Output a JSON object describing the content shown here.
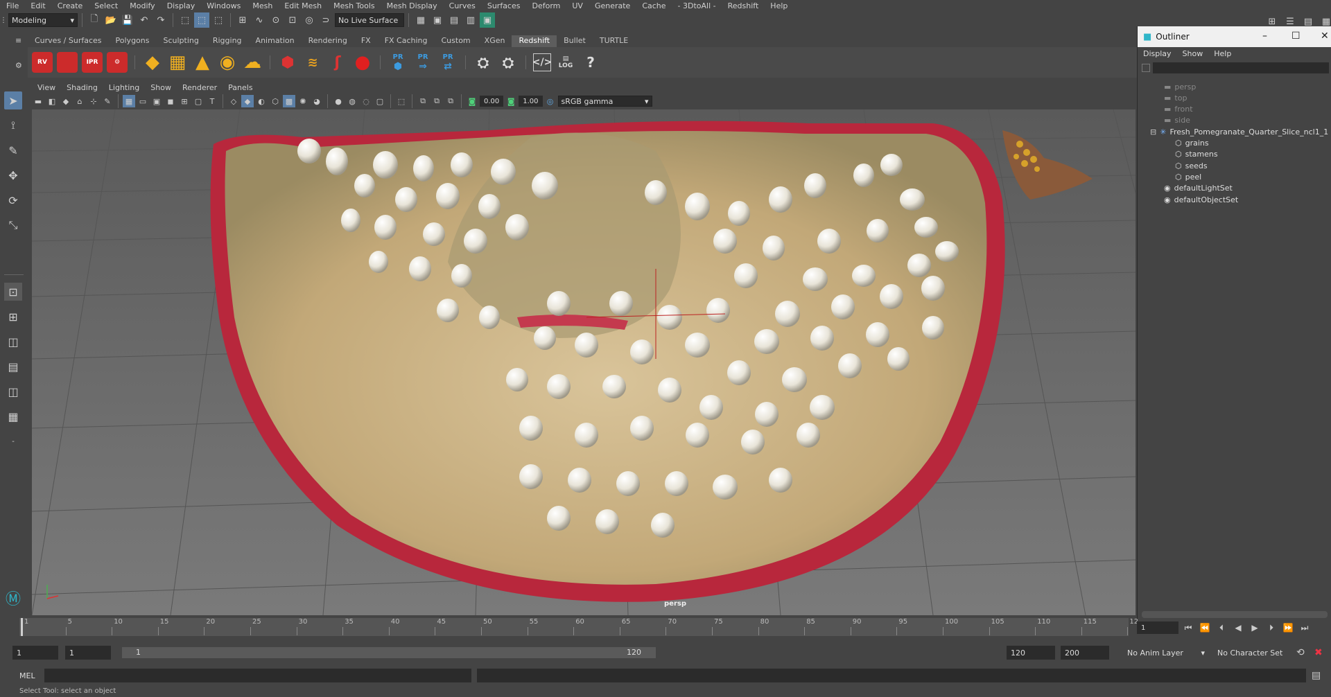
{
  "menubar": {
    "items": [
      "File",
      "Edit",
      "Create",
      "Select",
      "Modify",
      "Display",
      "Windows",
      "Mesh",
      "Edit Mesh",
      "Mesh Tools",
      "Mesh Display",
      "Curves",
      "Surfaces",
      "Deform",
      "UV",
      "Generate",
      "Cache",
      "- 3DtoAll -",
      "Redshift",
      "Help"
    ]
  },
  "statusline": {
    "mode": "Modeling",
    "live_surface": "No Live Surface"
  },
  "shelf": {
    "tabs": [
      "Curves / Surfaces",
      "Polygons",
      "Sculpting",
      "Rigging",
      "Animation",
      "Rendering",
      "FX",
      "FX Caching",
      "Custom",
      "XGen",
      "Redshift",
      "Bullet",
      "TURTLE"
    ],
    "active_tab": "Redshift",
    "icons": {
      "rv": "RV",
      "ipr": "IPR",
      "pr1": "PR",
      "pr2": "PR",
      "pr3": "PR",
      "log": "LOG",
      "help": "?"
    }
  },
  "panel": {
    "menus": [
      "View",
      "Shading",
      "Lighting",
      "Show",
      "Renderer",
      "Panels"
    ],
    "exposure": "0.00",
    "gamma": "1.00",
    "color_space": "sRGB gamma",
    "camera_label": "persp"
  },
  "outliner": {
    "title": "Outliner",
    "menus": [
      "Display",
      "Show",
      "Help"
    ],
    "items": [
      {
        "label": "persp",
        "type": "camera",
        "dim": true
      },
      {
        "label": "top",
        "type": "camera",
        "dim": true
      },
      {
        "label": "front",
        "type": "camera",
        "dim": true
      },
      {
        "label": "side",
        "type": "camera",
        "dim": true
      },
      {
        "label": "Fresh_Pomegranate_Quarter_Slice_ncl1_1",
        "type": "group",
        "dim": false
      },
      {
        "label": "grains",
        "type": "mesh",
        "dim": false
      },
      {
        "label": "stamens",
        "type": "mesh",
        "dim": false
      },
      {
        "label": "seeds",
        "type": "mesh",
        "dim": false
      },
      {
        "label": "peel",
        "type": "mesh",
        "dim": false
      },
      {
        "label": "defaultLightSet",
        "type": "set",
        "dim": false
      },
      {
        "label": "defaultObjectSet",
        "type": "set",
        "dim": false
      }
    ]
  },
  "timeline": {
    "ticks": [
      "1",
      "5",
      "10",
      "15",
      "20",
      "25",
      "30",
      "35",
      "40",
      "45",
      "50",
      "55",
      "60",
      "65",
      "70",
      "75",
      "80",
      "85",
      "90",
      "95",
      "100",
      "105",
      "110",
      "115",
      "12"
    ],
    "current_frame": "1"
  },
  "range": {
    "start": "1",
    "anim_start": "1",
    "slider_start": "1",
    "slider_end": "120",
    "anim_end": "120",
    "end": "200",
    "anim_layer": "No Anim Layer",
    "character_set": "No Character Set"
  },
  "cmdline": {
    "label": "MEL"
  },
  "helpline": {
    "text": "Select Tool: select an object"
  },
  "colors": {
    "accent": "#5b7fa6",
    "redshift_red": "#cc2b2b",
    "peel": "#b8273c",
    "flesh": "#c9b58a"
  }
}
